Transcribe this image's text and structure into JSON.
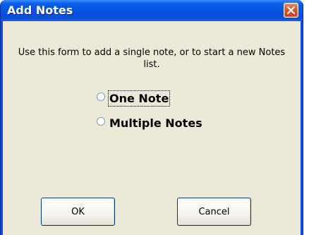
{
  "window": {
    "title": "Add Notes"
  },
  "message": "Use this form to add a single note, or to start a new Notes list.",
  "options": [
    {
      "label": "One Note",
      "selected": false,
      "focused": true
    },
    {
      "label": "Multiple Notes",
      "selected": false,
      "focused": false
    }
  ],
  "buttons": {
    "ok_label": "OK",
    "cancel_label": "Cancel"
  },
  "icons": {
    "close": "close-icon"
  },
  "colors": {
    "titlebar": "#0a4fd6",
    "client": "#ece9d8",
    "close_button": "#d7572f"
  }
}
